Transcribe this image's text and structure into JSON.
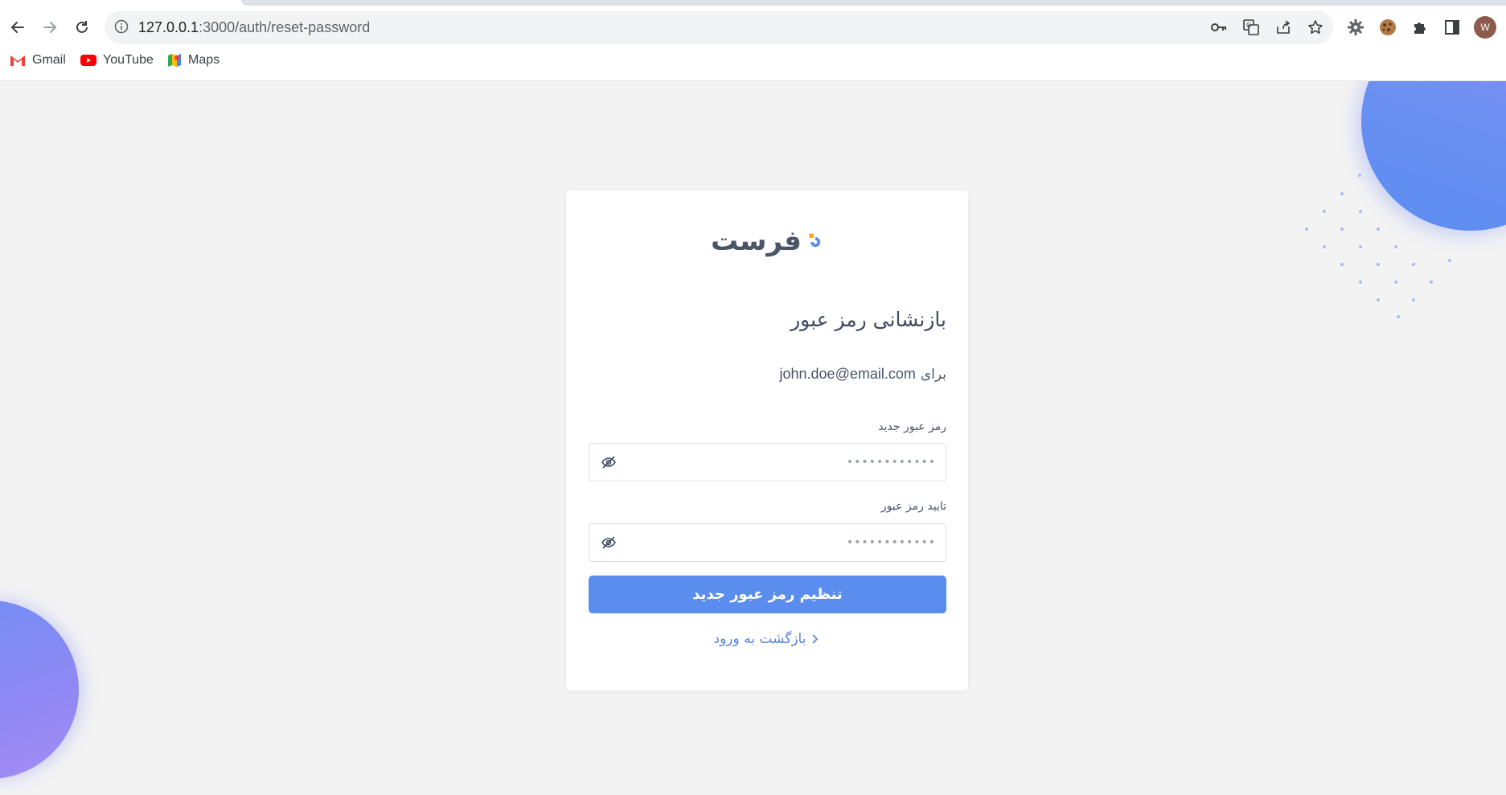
{
  "browser": {
    "url_host": "127.0.0.1",
    "url_path": ":3000/auth/reset-password",
    "profile_initial": "W",
    "bookmarks": [
      {
        "label": "Gmail",
        "icon": "gmail-icon"
      },
      {
        "label": "YouTube",
        "icon": "youtube-icon"
      },
      {
        "label": "Maps",
        "icon": "maps-icon"
      }
    ]
  },
  "card": {
    "logo_text": "فرست",
    "title": "بازنشانی رمز عبور",
    "subtitle_prefix": "برای",
    "email": "john.doe@email.com",
    "new_password_label": "رمز عبور جدید",
    "new_password_placeholder": "••••••••••••",
    "confirm_password_label": "تایید رمز عبور",
    "confirm_password_placeholder": "••••••••••••",
    "submit_label": "تنظیم رمز عبور جدید",
    "back_label": "بازگشت به ورود"
  },
  "colors": {
    "accent": "#5b8def",
    "logo_orange": "#f5a623",
    "text_dark": "#4a5568"
  }
}
